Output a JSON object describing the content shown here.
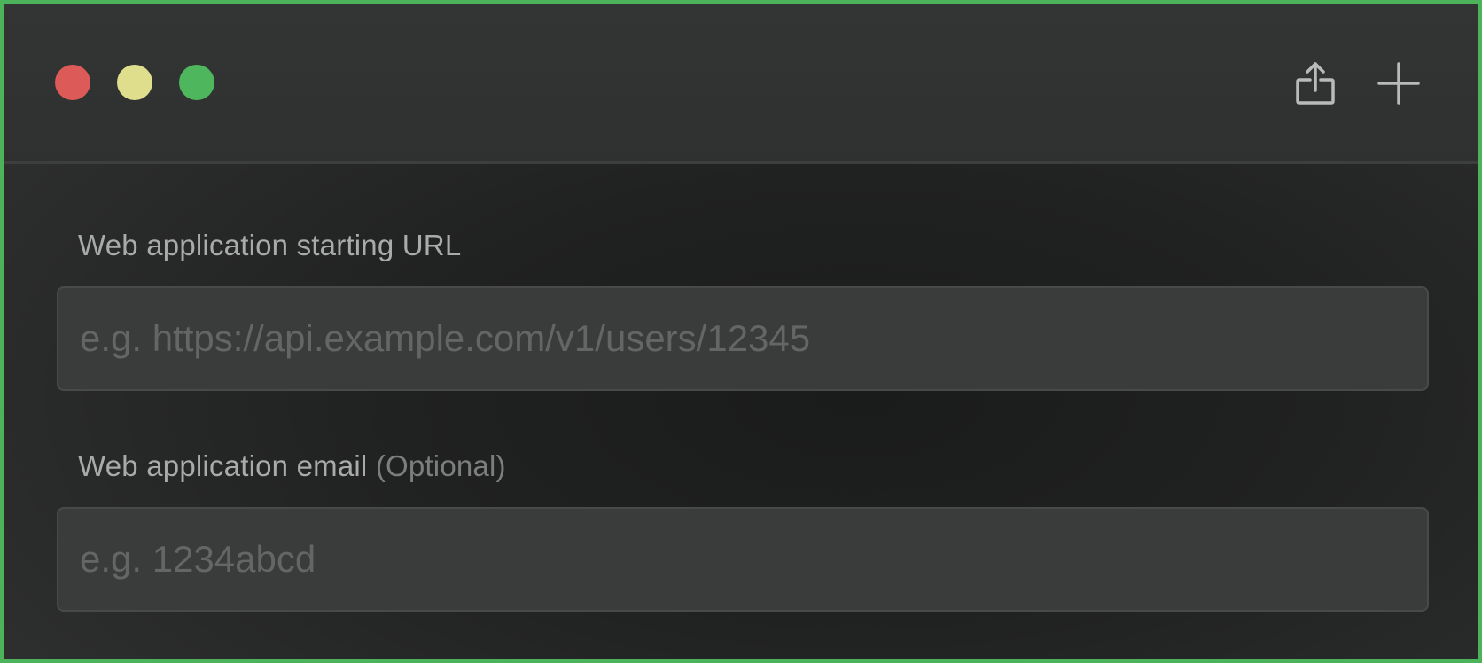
{
  "window": {
    "controls": {
      "close_color": "#dc5a57",
      "minimize_color": "#dede8c",
      "maximize_color": "#4eb75d"
    },
    "toolbar": {
      "share_icon": "share-icon",
      "add_icon": "plus-icon"
    }
  },
  "form": {
    "url": {
      "label": "Web application starting URL",
      "value": "",
      "placeholder": "e.g. https://api.example.com/v1/users/12345"
    },
    "email": {
      "label": "Web application email",
      "optional_label": "(Optional)",
      "value": "",
      "placeholder": "e.g. 1234abcd"
    }
  },
  "colors": {
    "window_border": "#4cb35a",
    "field_background": "#3a3b3b",
    "label_text": "#a9aaaa"
  }
}
